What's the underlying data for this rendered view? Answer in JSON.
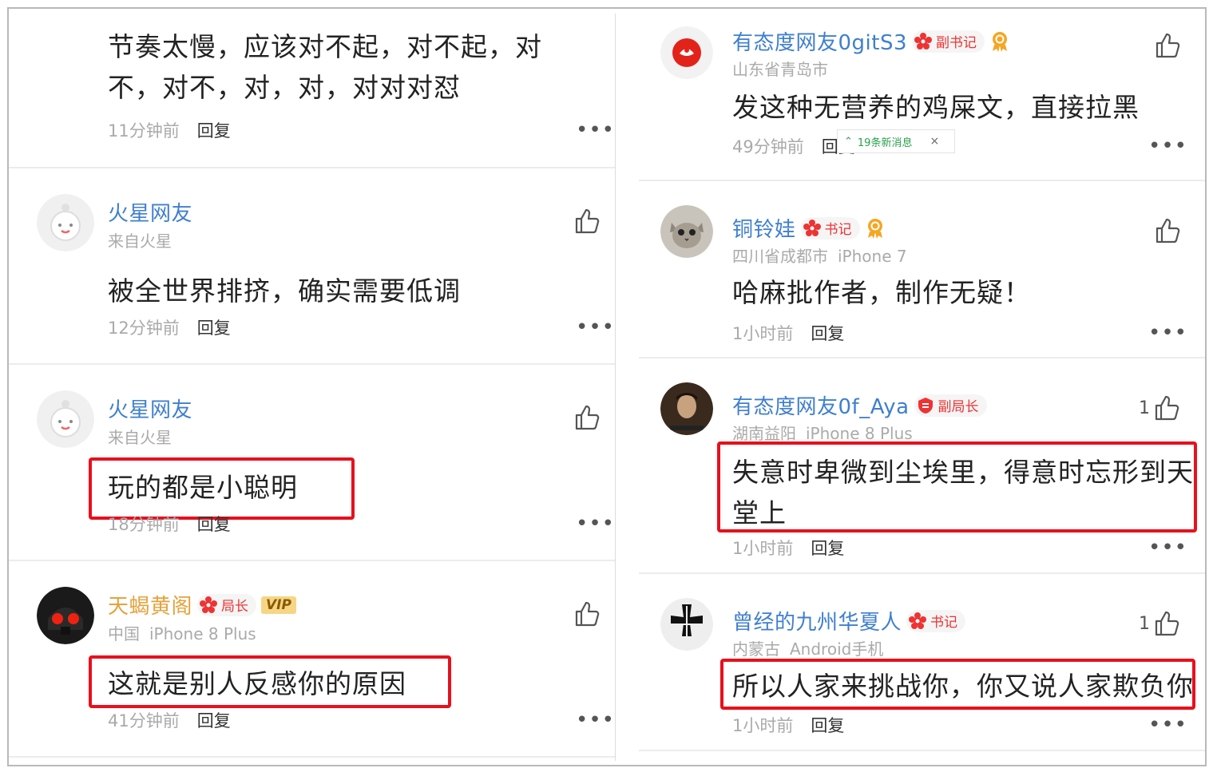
{
  "left": {
    "c0": {
      "content": "节奏太慢，应该对不起，对不起，对不，对不，对，对，对对对怼",
      "time": "11分钟前",
      "reply": "回复",
      "more": "•••"
    },
    "c1": {
      "name": "火星网友",
      "location": "来自火星",
      "content": "被全世界排挤，确实需要低调",
      "time": "12分钟前",
      "reply": "回复",
      "more": "•••",
      "avatar_icon": "mars-user-icon"
    },
    "c2": {
      "name": "火星网友",
      "location": "来自火星",
      "content": "玩的都是小聪明",
      "time": "18分钟前",
      "reply": "回复",
      "more": "•••",
      "avatar_icon": "mars-user-icon",
      "highlighted": true
    },
    "c3": {
      "name": "天蝎黄阁",
      "badge": "局长",
      "vip": "VIP",
      "location": "中国",
      "device": "iPhone 8 Plus",
      "content": "这就是别人反感你的原因",
      "time": "41分钟前",
      "reply": "回复",
      "more": "•••",
      "avatar_icon": "dark-helmet-avatar",
      "highlighted": true
    }
  },
  "right": {
    "c0": {
      "name": "有态度网友0gitS3",
      "badge": "副书记",
      "location": "山东省青岛市",
      "content": "发这种无营养的鸡屎文，直接拉黑",
      "time": "49分钟前",
      "reply": "回复",
      "more": "•••",
      "avatar_icon": "netease-logo-avatar"
    },
    "c1": {
      "name": "铜铃娃",
      "badge": "书记",
      "location": "四川省成都市",
      "device": "iPhone 7",
      "content": "哈麻批作者，制作无疑！",
      "time": "1小时前",
      "reply": "回复",
      "more": "•••",
      "avatar_icon": "cat-avatar"
    },
    "c2": {
      "name": "有态度网友0f_Aya",
      "badge": "副局长",
      "location": "湖南益阳",
      "device": "iPhone 8 Plus",
      "content": "失意时卑微到尘埃里，得意时忘形到天堂上",
      "time": "1小时前",
      "reply": "回复",
      "more": "•••",
      "likes": "1",
      "avatar_icon": "portrait-avatar",
      "highlighted": true
    },
    "c3": {
      "name": "曾经的九州华夏人",
      "badge": "书记",
      "location": "内蒙古",
      "device": "Android手机",
      "content": "所以人家来挑战你，你又说人家欺负你",
      "time": "1小时前",
      "reply": "回复",
      "more": "•••",
      "likes": "1",
      "avatar_icon": "iron-cross-avatar",
      "highlighted": true
    }
  },
  "toast": {
    "text": "19条新消息",
    "close": "×"
  },
  "colors": {
    "username": "#3f7fcf",
    "username_vip": "#e6a23c",
    "highlight_box": "#e8101c",
    "badge_text": "#e33"
  }
}
